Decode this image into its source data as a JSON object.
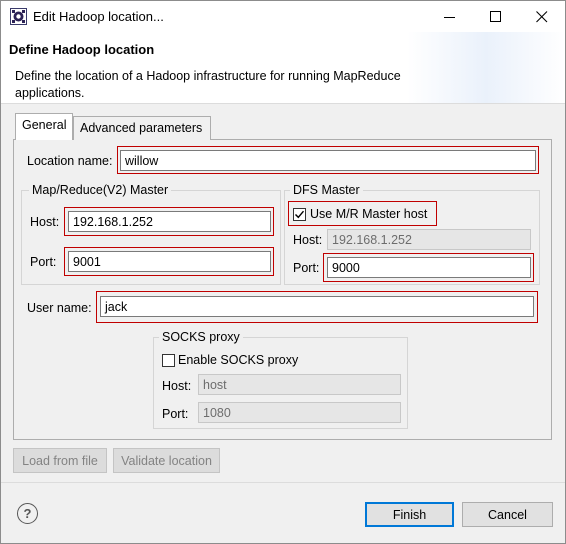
{
  "window": {
    "title": "Edit Hadoop location...",
    "minimize_glyph": "—",
    "maximize_glyph": "☐",
    "close_glyph": "✕"
  },
  "header": {
    "title": "Define Hadoop location",
    "description": "Define the location of a Hadoop infrastructure for running MapReduce applications."
  },
  "tabs": [
    {
      "label": "General",
      "selected": true
    },
    {
      "label": "Advanced parameters",
      "selected": false
    }
  ],
  "general": {
    "location_name": {
      "label": "Location name:",
      "value": "willow"
    },
    "mr_master": {
      "title": "Map/Reduce(V2) Master",
      "host_label": "Host:",
      "host_value": "192.168.1.252",
      "port_label": "Port:",
      "port_value": "9001"
    },
    "dfs_master": {
      "title": "DFS Master",
      "use_mr_label": "Use M/R Master host",
      "use_mr_checked": true,
      "host_label": "Host:",
      "host_value": "192.168.1.252",
      "port_label": "Port:",
      "port_value": "9000"
    },
    "user_name": {
      "label": "User name:",
      "value": "jack"
    },
    "socks": {
      "title": "SOCKS proxy",
      "enable_label": "Enable SOCKS proxy",
      "enable_checked": false,
      "host_label": "Host:",
      "host_value": "host",
      "port_label": "Port:",
      "port_value": "1080"
    }
  },
  "buttons": {
    "load_from_file": "Load from file",
    "validate_location": "Validate location",
    "finish": "Finish",
    "cancel": "Cancel",
    "help_glyph": "?"
  },
  "colors": {
    "highlight_box": "#c00000",
    "default_button_border": "#0078d7"
  }
}
